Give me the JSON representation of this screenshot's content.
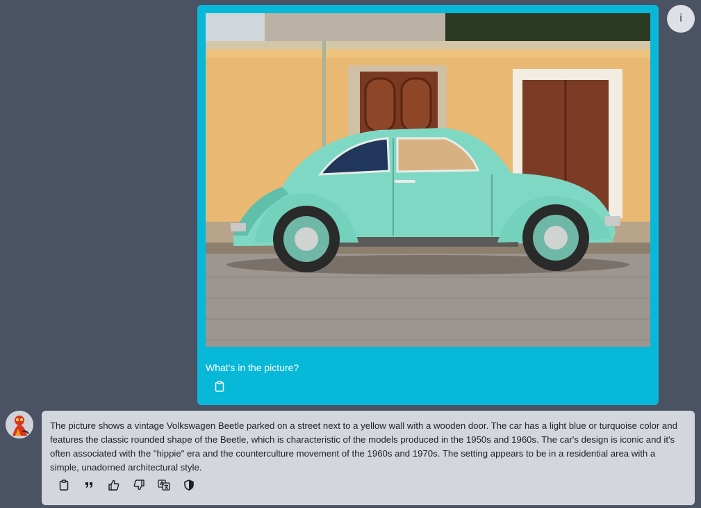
{
  "user": {
    "avatar_letter": "i",
    "message_text": "What's in the picture?",
    "copy_icon": "clipboard-icon"
  },
  "assistant": {
    "message_text": "The picture shows a vintage Volkswagen Beetle parked on a street next to a yellow wall with a wooden door. The car has a light blue or turquoise color and features the classic rounded shape of the Beetle, which is characteristic of the models produced in the 1950s and 1960s. The car's design is iconic and it's often associated with the \"hippie\" era and the counterculture movement of the 1960s and 1970s. The setting appears to be in a residential area with a simple, unadorned architectural style.",
    "actions": [
      "clipboard-icon",
      "quote-icon",
      "thumbs-up-icon",
      "thumbs-down-icon",
      "translate-icon",
      "shield-icon"
    ]
  },
  "colors": {
    "background": "#4b5263",
    "user_bubble": "#08b8d9",
    "assistant_bubble": "#d4d6de"
  }
}
